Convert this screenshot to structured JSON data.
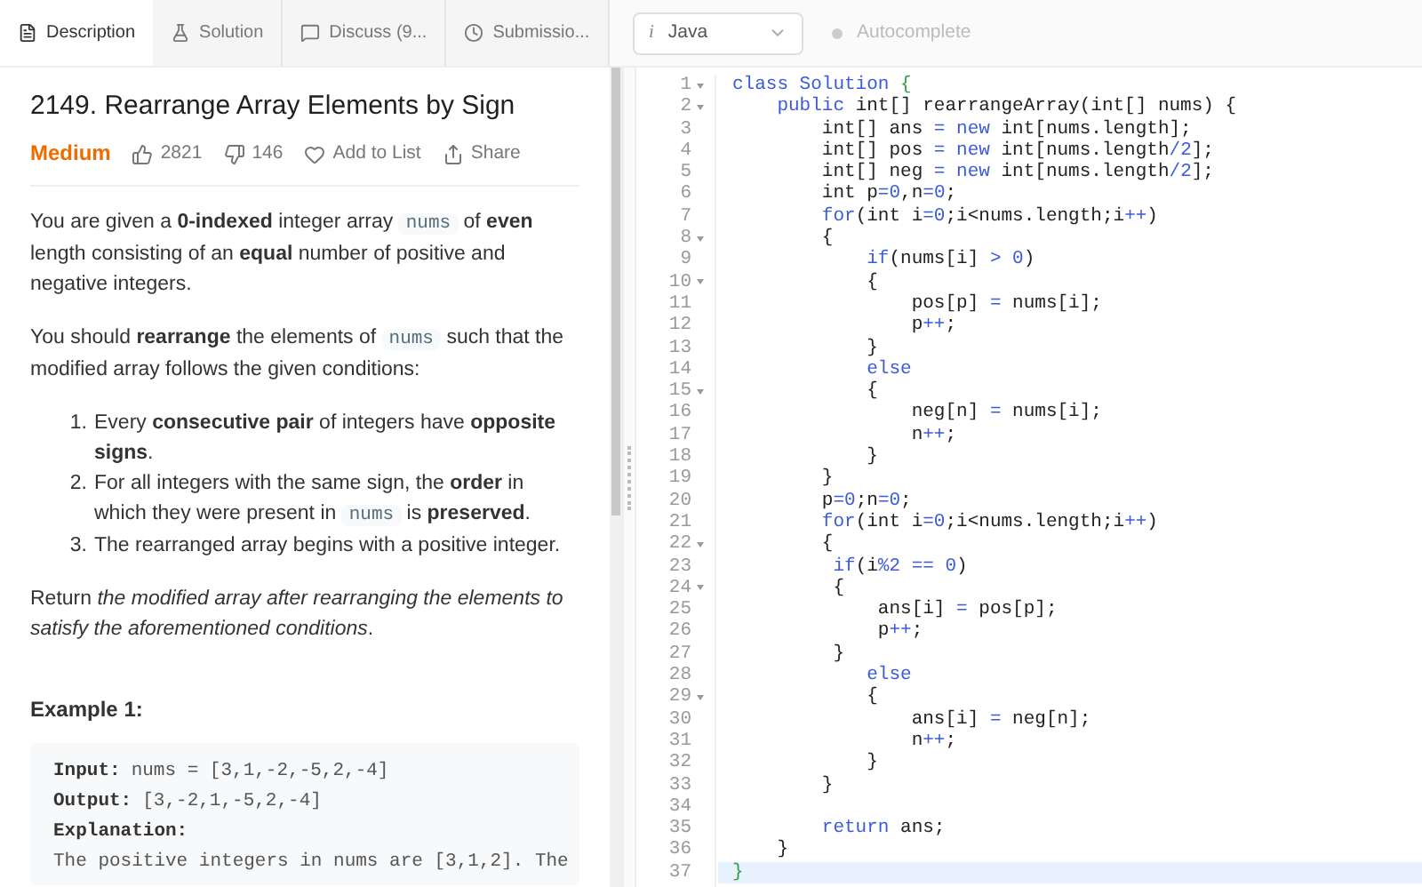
{
  "tabs": [
    {
      "label": "Description",
      "selected": true
    },
    {
      "label": "Solution",
      "selected": false
    },
    {
      "label": "Discuss (9...",
      "selected": false
    },
    {
      "label": "Submissio...",
      "selected": false
    }
  ],
  "language_select": {
    "icon_text": "i",
    "value": "Java"
  },
  "autocomplete": {
    "label": "Autocomplete",
    "on": false
  },
  "problem": {
    "title": "2149. Rearrange Array Elements by Sign",
    "difficulty": "Medium",
    "likes": "2821",
    "dislikes": "146",
    "add_to_list": "Add to List",
    "share": "Share"
  },
  "description": [
    {
      "kind": "para",
      "segments": [
        {
          "kind": "text",
          "text": "You are given a **0-indexed** integer array "
        },
        {
          "kind": "code",
          "text": "nums"
        },
        {
          "kind": "text",
          "text": " of **even** length consisting of an **equal** number of positive and negative integers."
        }
      ]
    },
    {
      "kind": "para",
      "segments": [
        {
          "kind": "text",
          "text": "You should **rearrange** the elements of "
        },
        {
          "kind": "code",
          "text": "nums"
        },
        {
          "kind": "text",
          "text": " such that the modified array follows the given conditions:"
        }
      ]
    },
    {
      "kind": "list",
      "items": [
        {
          "number": "1.",
          "segments": [
            {
              "kind": "text",
              "text": "Every **consecutive pair** of integers have **opposite signs**."
            }
          ]
        },
        {
          "number": "2.",
          "segments": [
            {
              "kind": "text",
              "text": "For all integers with the same sign, the **order** in which they were present in "
            },
            {
              "kind": "code",
              "text": "nums"
            },
            {
              "kind": "text",
              "text": " is **preserved**."
            }
          ]
        },
        {
          "number": "3.",
          "segments": [
            {
              "kind": "text",
              "text": "The rearranged array begins with a positive integer."
            }
          ]
        }
      ]
    },
    {
      "kind": "para",
      "segments": [
        {
          "kind": "text",
          "text": "Return *the modified array after rearranging the elements to satisfy the aforementioned conditions*."
        }
      ]
    }
  ],
  "example": {
    "title": "Example 1:",
    "lines": [
      {
        "label": "Input:",
        "value": "nums = [3,1,-2,-5,2,-4]"
      },
      {
        "label": "Output:",
        "value": "[3,-2,1,-5,2,-4]"
      },
      {
        "label": "Explanation:"
      },
      {
        "value": "The positive integers in nums are [3,1,2]. The"
      }
    ]
  },
  "code_lines": [
    {
      "number": "1",
      "foldable": true,
      "highlighted": false,
      "tokens": [
        {
          "kind": "keyword",
          "text": "class Solution "
        },
        {
          "kind": "brace",
          "text": "{"
        }
      ]
    },
    {
      "number": "2",
      "foldable": true,
      "highlighted": false,
      "tokens": [
        {
          "kind": "keyword",
          "text": "    public"
        },
        {
          "kind": "plain",
          "text": " int[] rearrangeArray(int[] nums) {"
        }
      ]
    },
    {
      "number": "3",
      "foldable": false,
      "highlighted": false,
      "tokens": [
        {
          "kind": "plain",
          "text": "        int[] ans "
        },
        {
          "kind": "keyword",
          "text": "= new"
        },
        {
          "kind": "plain",
          "text": " int[nums.length];"
        }
      ]
    },
    {
      "number": "4",
      "foldable": false,
      "highlighted": false,
      "tokens": [
        {
          "kind": "plain",
          "text": "        int[] pos "
        },
        {
          "kind": "keyword",
          "text": "= new"
        },
        {
          "kind": "plain",
          "text": " int[nums.length"
        },
        {
          "kind": "keyword",
          "text": "/2"
        },
        {
          "kind": "plain",
          "text": "];"
        }
      ]
    },
    {
      "number": "5",
      "foldable": false,
      "highlighted": false,
      "tokens": [
        {
          "kind": "plain",
          "text": "        int[] neg "
        },
        {
          "kind": "keyword",
          "text": "= new"
        },
        {
          "kind": "plain",
          "text": " int[nums.length"
        },
        {
          "kind": "keyword",
          "text": "/2"
        },
        {
          "kind": "plain",
          "text": "];"
        }
      ]
    },
    {
      "number": "6",
      "foldable": false,
      "highlighted": false,
      "tokens": [
        {
          "kind": "plain",
          "text": "        int p"
        },
        {
          "kind": "keyword",
          "text": "=0"
        },
        {
          "kind": "plain",
          "text": ",n"
        },
        {
          "kind": "keyword",
          "text": "=0"
        },
        {
          "kind": "plain",
          "text": ";"
        }
      ]
    },
    {
      "number": "7",
      "foldable": false,
      "highlighted": false,
      "tokens": [
        {
          "kind": "keyword",
          "text": "        for"
        },
        {
          "kind": "plain",
          "text": "(int i"
        },
        {
          "kind": "keyword",
          "text": "=0"
        },
        {
          "kind": "plain",
          "text": ";i<nums.length;i"
        },
        {
          "kind": "keyword",
          "text": "++"
        },
        {
          "kind": "plain",
          "text": ")"
        }
      ]
    },
    {
      "number": "8",
      "foldable": true,
      "highlighted": false,
      "tokens": [
        {
          "kind": "plain",
          "text": "        {"
        }
      ]
    },
    {
      "number": "9",
      "foldable": false,
      "highlighted": false,
      "tokens": [
        {
          "kind": "keyword",
          "text": "            if"
        },
        {
          "kind": "plain",
          "text": "(nums[i] "
        },
        {
          "kind": "keyword",
          "text": "> 0"
        },
        {
          "kind": "plain",
          "text": ")"
        }
      ]
    },
    {
      "number": "10",
      "foldable": true,
      "highlighted": false,
      "tokens": [
        {
          "kind": "plain",
          "text": "            {"
        }
      ]
    },
    {
      "number": "11",
      "foldable": false,
      "highlighted": false,
      "tokens": [
        {
          "kind": "plain",
          "text": "                pos[p] "
        },
        {
          "kind": "keyword",
          "text": "="
        },
        {
          "kind": "plain",
          "text": " nums[i];"
        }
      ]
    },
    {
      "number": "12",
      "foldable": false,
      "highlighted": false,
      "tokens": [
        {
          "kind": "plain",
          "text": "                p"
        },
        {
          "kind": "keyword",
          "text": "++"
        },
        {
          "kind": "plain",
          "text": ";"
        }
      ]
    },
    {
      "number": "13",
      "foldable": false,
      "highlighted": false,
      "tokens": [
        {
          "kind": "plain",
          "text": "            }"
        }
      ]
    },
    {
      "number": "14",
      "foldable": false,
      "highlighted": false,
      "tokens": [
        {
          "kind": "keyword",
          "text": "            else"
        }
      ]
    },
    {
      "number": "15",
      "foldable": true,
      "highlighted": false,
      "tokens": [
        {
          "kind": "plain",
          "text": "            {"
        }
      ]
    },
    {
      "number": "16",
      "foldable": false,
      "highlighted": false,
      "tokens": [
        {
          "kind": "plain",
          "text": "                neg[n] "
        },
        {
          "kind": "keyword",
          "text": "="
        },
        {
          "kind": "plain",
          "text": " nums[i];"
        }
      ]
    },
    {
      "number": "17",
      "foldable": false,
      "highlighted": false,
      "tokens": [
        {
          "kind": "plain",
          "text": "                n"
        },
        {
          "kind": "keyword",
          "text": "++"
        },
        {
          "kind": "plain",
          "text": ";"
        }
      ]
    },
    {
      "number": "18",
      "foldable": false,
      "highlighted": false,
      "tokens": [
        {
          "kind": "plain",
          "text": "            }"
        }
      ]
    },
    {
      "number": "19",
      "foldable": false,
      "highlighted": false,
      "tokens": [
        {
          "kind": "plain",
          "text": "        }"
        }
      ]
    },
    {
      "number": "20",
      "foldable": false,
      "highlighted": false,
      "tokens": [
        {
          "kind": "plain",
          "text": "        p"
        },
        {
          "kind": "keyword",
          "text": "=0"
        },
        {
          "kind": "plain",
          "text": ";n"
        },
        {
          "kind": "keyword",
          "text": "=0"
        },
        {
          "kind": "plain",
          "text": ";"
        }
      ]
    },
    {
      "number": "21",
      "foldable": false,
      "highlighted": false,
      "tokens": [
        {
          "kind": "keyword",
          "text": "        for"
        },
        {
          "kind": "plain",
          "text": "(int i"
        },
        {
          "kind": "keyword",
          "text": "=0"
        },
        {
          "kind": "plain",
          "text": ";i<nums.length;i"
        },
        {
          "kind": "keyword",
          "text": "++"
        },
        {
          "kind": "plain",
          "text": ")"
        }
      ]
    },
    {
      "number": "22",
      "foldable": true,
      "highlighted": false,
      "tokens": [
        {
          "kind": "plain",
          "text": "        {"
        }
      ]
    },
    {
      "number": "23",
      "foldable": false,
      "highlighted": false,
      "tokens": [
        {
          "kind": "keyword",
          "text": "         if"
        },
        {
          "kind": "plain",
          "text": "(i"
        },
        {
          "kind": "keyword",
          "text": "%2 == 0"
        },
        {
          "kind": "plain",
          "text": ")"
        }
      ]
    },
    {
      "number": "24",
      "foldable": true,
      "highlighted": false,
      "tokens": [
        {
          "kind": "plain",
          "text": "         {"
        }
      ]
    },
    {
      "number": "25",
      "foldable": false,
      "highlighted": false,
      "tokens": [
        {
          "kind": "plain",
          "text": "             ans[i] "
        },
        {
          "kind": "keyword",
          "text": "="
        },
        {
          "kind": "plain",
          "text": " pos[p];"
        }
      ]
    },
    {
      "number": "26",
      "foldable": false,
      "highlighted": false,
      "tokens": [
        {
          "kind": "plain",
          "text": "             p"
        },
        {
          "kind": "keyword",
          "text": "++"
        },
        {
          "kind": "plain",
          "text": ";"
        }
      ]
    },
    {
      "number": "27",
      "foldable": false,
      "highlighted": false,
      "tokens": [
        {
          "kind": "plain",
          "text": "         }"
        }
      ]
    },
    {
      "number": "28",
      "foldable": false,
      "highlighted": false,
      "tokens": [
        {
          "kind": "keyword",
          "text": "            else"
        }
      ]
    },
    {
      "number": "29",
      "foldable": true,
      "highlighted": false,
      "tokens": [
        {
          "kind": "plain",
          "text": "            {"
        }
      ]
    },
    {
      "number": "30",
      "foldable": false,
      "highlighted": false,
      "tokens": [
        {
          "kind": "plain",
          "text": "                ans[i] "
        },
        {
          "kind": "keyword",
          "text": "="
        },
        {
          "kind": "plain",
          "text": " neg[n];"
        }
      ]
    },
    {
      "number": "31",
      "foldable": false,
      "highlighted": false,
      "tokens": [
        {
          "kind": "plain",
          "text": "                n"
        },
        {
          "kind": "keyword",
          "text": "++"
        },
        {
          "kind": "plain",
          "text": ";"
        }
      ]
    },
    {
      "number": "32",
      "foldable": false,
      "highlighted": false,
      "tokens": [
        {
          "kind": "plain",
          "text": "            }"
        }
      ]
    },
    {
      "number": "33",
      "foldable": false,
      "highlighted": false,
      "tokens": [
        {
          "kind": "plain",
          "text": "        }"
        }
      ]
    },
    {
      "number": "34",
      "foldable": false,
      "highlighted": false
    },
    {
      "number": "35",
      "foldable": false,
      "highlighted": false,
      "tokens": [
        {
          "kind": "keyword",
          "text": "        return"
        },
        {
          "kind": "plain",
          "text": " ans;"
        }
      ]
    },
    {
      "number": "36",
      "foldable": false,
      "highlighted": false,
      "tokens": [
        {
          "kind": "plain",
          "text": "    }"
        }
      ]
    },
    {
      "number": "37",
      "foldable": false,
      "highlighted": true,
      "tokens": [
        {
          "kind": "brace",
          "text": "}"
        }
      ]
    }
  ]
}
